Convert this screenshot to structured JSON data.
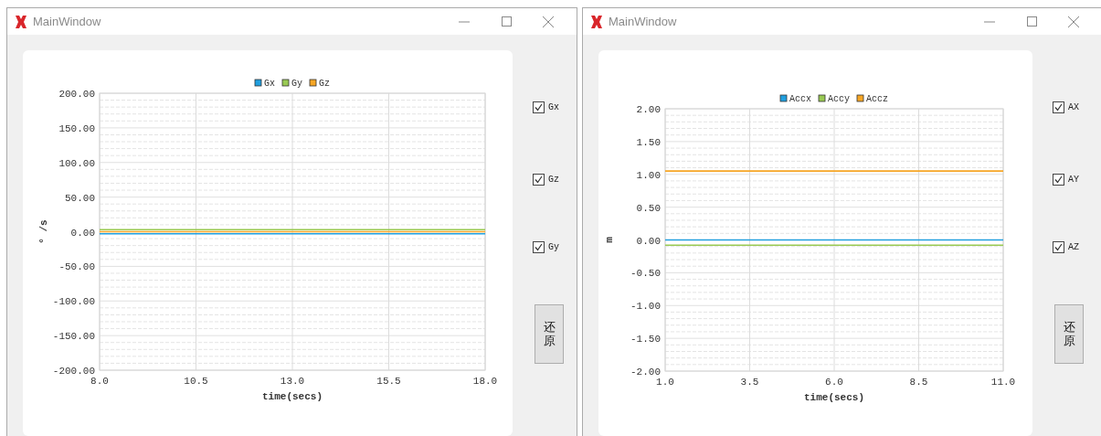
{
  "windows": [
    {
      "title": "MainWindow",
      "chart_data": {
        "type": "line",
        "grid": true,
        "legend": true,
        "xlabel": "time(secs)",
        "ylabel": "° /s",
        "xlim": [
          8,
          18
        ],
        "ylim": [
          -200,
          200
        ],
        "xticks": [
          {
            "value": 8,
            "label": "8.0"
          },
          {
            "value": 10.5,
            "label": "10.5"
          },
          {
            "value": 13,
            "label": "13.0"
          },
          {
            "value": 15.5,
            "label": "15.5"
          },
          {
            "value": 18,
            "label": "18.0"
          }
        ],
        "yticks": [
          {
            "value": 200,
            "label": "200.00"
          },
          {
            "value": 150,
            "label": "150.00"
          },
          {
            "value": 100,
            "label": "100.00"
          },
          {
            "value": 50,
            "label": "50.00"
          },
          {
            "value": 0,
            "label": "0.00"
          },
          {
            "value": -50,
            "label": "-50.00"
          },
          {
            "value": -100,
            "label": "-100.00"
          },
          {
            "value": -150,
            "label": "-150.00"
          },
          {
            "value": -200,
            "label": "-200.00"
          }
        ],
        "x": [
          8,
          18
        ],
        "series": [
          {
            "name": "Gx",
            "color": "#209fdf",
            "values": [
              -3,
              -3
            ]
          },
          {
            "name": "Gy",
            "color": "#99ca53",
            "values": [
              3,
              3
            ]
          },
          {
            "name": "Gz",
            "color": "#f6a625",
            "values": [
              0,
              0
            ]
          }
        ]
      },
      "checkboxes": [
        {
          "label": "Gx",
          "checked": true
        },
        {
          "label": "Gz",
          "checked": true
        },
        {
          "label": "Gy",
          "checked": true
        }
      ],
      "button": "还原"
    },
    {
      "title": "MainWindow",
      "chart_data": {
        "type": "line",
        "grid": true,
        "legend": true,
        "xlabel": "time(secs)",
        "ylabel": "m",
        "xlim": [
          1,
          11
        ],
        "ylim": [
          -2,
          2
        ],
        "xticks": [
          {
            "value": 1,
            "label": "1.0"
          },
          {
            "value": 3.5,
            "label": "3.5"
          },
          {
            "value": 6,
            "label": "6.0"
          },
          {
            "value": 8.5,
            "label": "8.5"
          },
          {
            "value": 11,
            "label": "11.0"
          }
        ],
        "yticks": [
          {
            "value": 2,
            "label": "2.00"
          },
          {
            "value": 1.5,
            "label": "1.50"
          },
          {
            "value": 1,
            "label": "1.00"
          },
          {
            "value": 0.5,
            "label": "0.50"
          },
          {
            "value": 0,
            "label": "0.00"
          },
          {
            "value": -0.5,
            "label": "-0.50"
          },
          {
            "value": -1,
            "label": "-1.00"
          },
          {
            "value": -1.5,
            "label": "-1.50"
          },
          {
            "value": -2,
            "label": "-2.00"
          }
        ],
        "x": [
          1,
          11
        ],
        "series": [
          {
            "name": "Accx",
            "color": "#209fdf",
            "values": [
              0,
              0
            ]
          },
          {
            "name": "Accy",
            "color": "#99ca53",
            "values": [
              -0.08,
              -0.08
            ]
          },
          {
            "name": "Accz",
            "color": "#f6a625",
            "values": [
              1.05,
              1.05
            ]
          }
        ]
      },
      "checkboxes": [
        {
          "label": "AX",
          "checked": true
        },
        {
          "label": "AY",
          "checked": true
        },
        {
          "label": "AZ",
          "checked": true
        }
      ],
      "button": "还原"
    }
  ]
}
